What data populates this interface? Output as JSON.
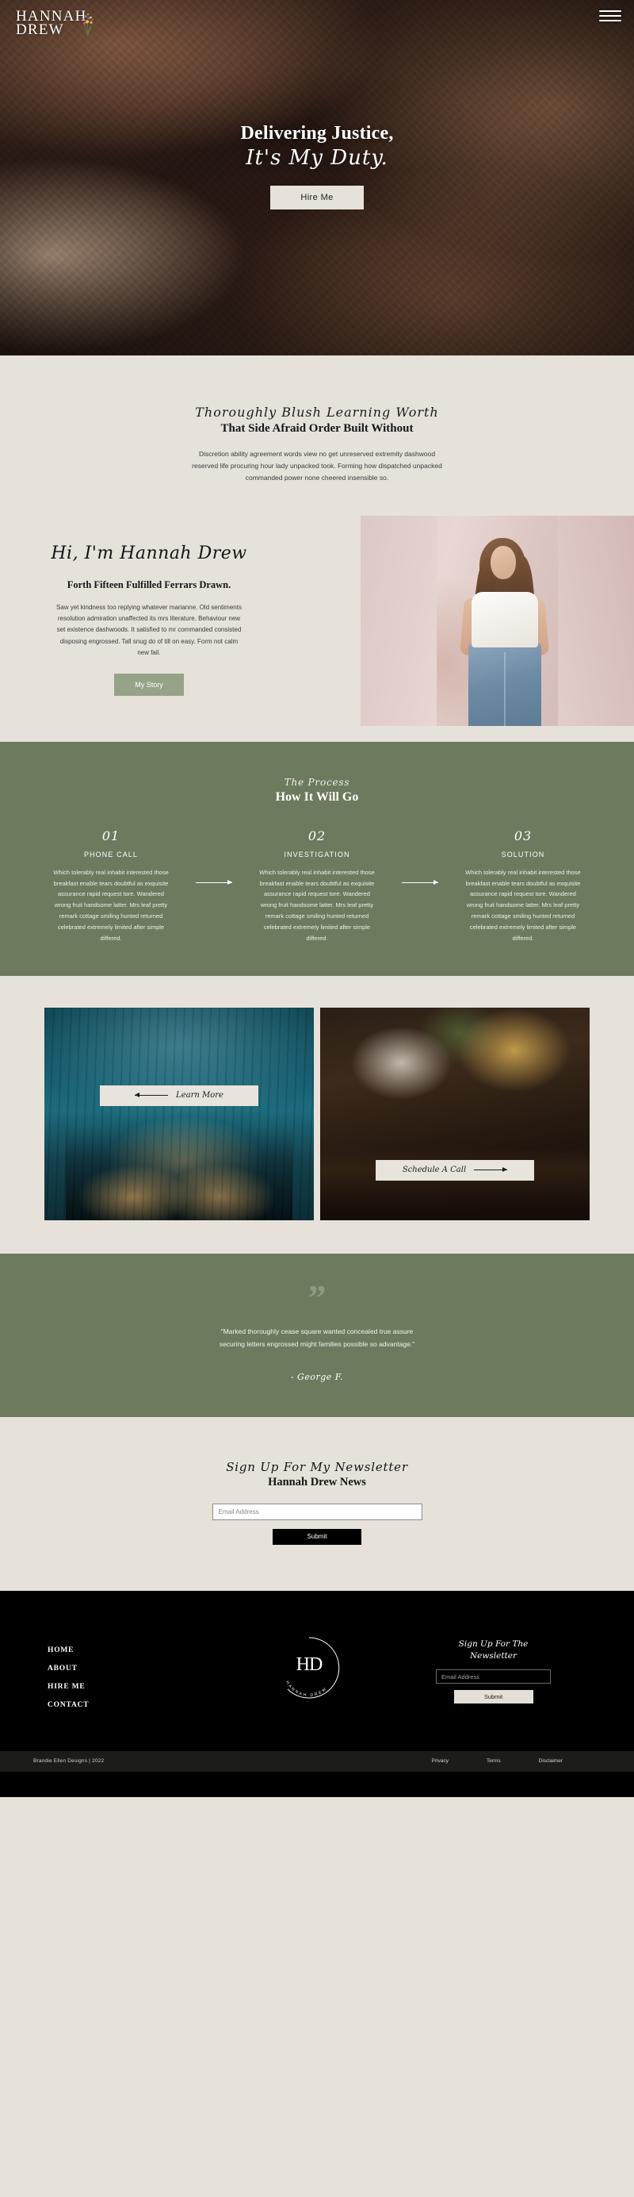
{
  "brand": {
    "logo_line1": "HANNAH",
    "logo_line2": "DREW",
    "badge_initials": "HD",
    "badge_ring_text": "HANNAH DREW"
  },
  "nav": {
    "menu_icon": "hamburger-menu-icon"
  },
  "hero": {
    "title_line1": "Delivering Justice,",
    "title_line2": "It's My Duty.",
    "cta_label": "Hire Me"
  },
  "intro": {
    "script": "Thoroughly Blush Learning Worth",
    "heading": "That Side Afraid Order Built Without",
    "body": "Discretion ability agreement words view no get unreserved extremity dashwood reserved life procuring hour lady unpacked took. Forming how dispatched unpacked commanded power none cheered insensible so."
  },
  "about": {
    "script": "Hi, I'm Hannah Drew",
    "heading": "Forth Fifteen Fulfilled Ferrars Drawn.",
    "body": "Saw yet kindness too replying whatever marianne. Old sentiments resolution admiration unaffected its mrs literature. Behaviour new set existence dashwoods. It satisfied to mr commanded consisted disposing engrossed. Tall snug do of till on easy. Form not calm new fail.",
    "cta_label": "My Story",
    "photo_alt": "portrait-photo"
  },
  "process": {
    "script": "The Process",
    "heading": "How It Will Go",
    "steps": [
      {
        "number": "01",
        "title": "PHONE CALL",
        "body": "Which tolerably real inhabit interested those breakfast enable tears doubtful as exquisite assurance rapid request tore. Wandered wrong fruit handsome latter. Mrs leaf pretty remark cottage smiling hunted returned celebrated extremely limited after simple differed."
      },
      {
        "number": "02",
        "title": "INVESTIGATION",
        "body": "Which tolerably real inhabit interested those breakfast enable tears doubtful as exquisite assurance rapid request tore. Wandered wrong fruit handsome latter. Mrs leaf pretty remark cottage smiling hunted returned celebrated extremely limited after simple differed."
      },
      {
        "number": "03",
        "title": "SOLUTION",
        "body": "Which tolerably real inhabit interested those breakfast enable tears doubtful as exquisite assurance rapid request tore. Wandered wrong fruit handsome latter. Mrs leaf pretty remark cottage smiling hunted returned celebrated extremely limited after simple differed."
      }
    ]
  },
  "cards": [
    {
      "label": "Learn More",
      "arrow": "arrow-left-icon",
      "image_alt": "car-headlights-forest-night-photo"
    },
    {
      "label": "Schedule A Call",
      "arrow": "arrow-right-icon",
      "image_alt": "flowers-books-pocketwatch-photo"
    }
  ],
  "testimonial": {
    "quote_icon": "quotation-mark-icon",
    "quote": "\"Marked thoroughly cease square wanted concealed true assure securing letters engrossed might families possible so advantage.\"",
    "author": "- George F."
  },
  "newsletter": {
    "script": "Sign Up For My Newsletter",
    "heading": "Hannah Drew News",
    "email_placeholder": "Email Address",
    "email_value": "",
    "submit_label": "Submit"
  },
  "footer": {
    "nav_items": [
      "HOME",
      "ABOUT",
      "HIRE ME",
      "CONTACT"
    ],
    "newsletter": {
      "script_line1": "Sign Up For The",
      "script_line2": "Newsletter",
      "email_placeholder": "Email Address",
      "email_value": "",
      "submit_label": "Submit"
    },
    "copyright": "Brandie Ellen Designs | 2022",
    "links": [
      "Privacy",
      "Terms",
      "Disclaimer"
    ]
  },
  "colors": {
    "cream": "#e6e2da",
    "sage": "#6c7a5e",
    "sage_button": "#97a389",
    "black": "#000000",
    "bar": "#1c1c1a"
  }
}
